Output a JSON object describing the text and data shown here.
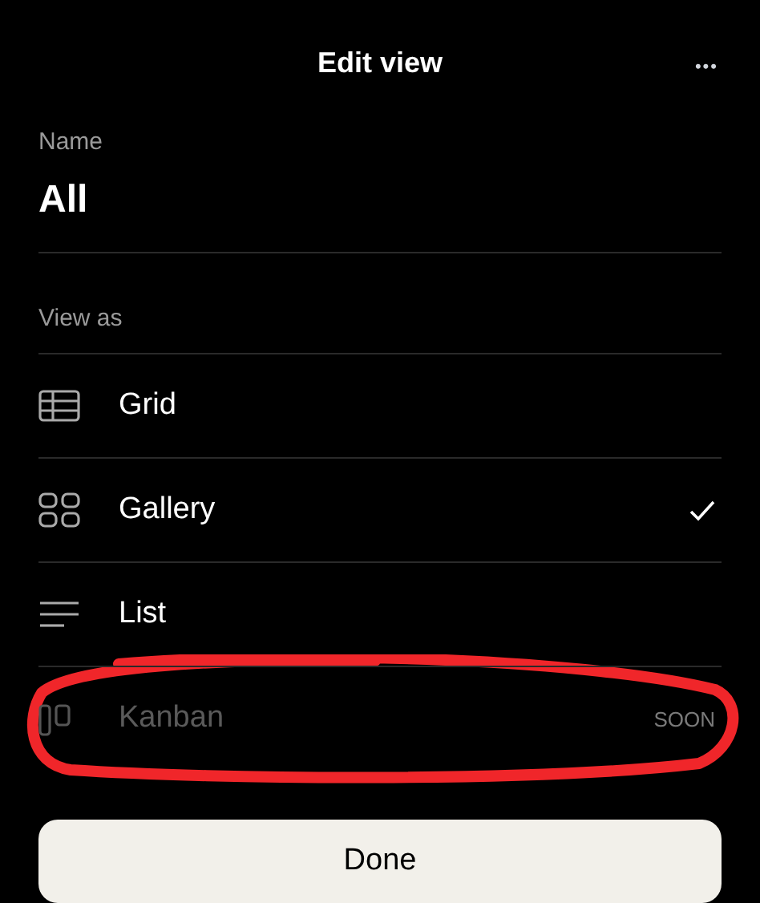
{
  "header": {
    "title": "Edit view",
    "menu": "•••"
  },
  "name": {
    "label": "Name",
    "value": "All"
  },
  "view_as": {
    "label": "View as",
    "options": [
      {
        "label": "Grid",
        "selected": false,
        "disabled": false,
        "circled": false
      },
      {
        "label": "Gallery",
        "selected": true,
        "disabled": false,
        "circled": false
      },
      {
        "label": "List",
        "selected": false,
        "disabled": false,
        "circled": false
      },
      {
        "label": "Kanban",
        "selected": false,
        "disabled": true,
        "badge": "SOON",
        "circled": true
      }
    ]
  },
  "done_button": "Done"
}
